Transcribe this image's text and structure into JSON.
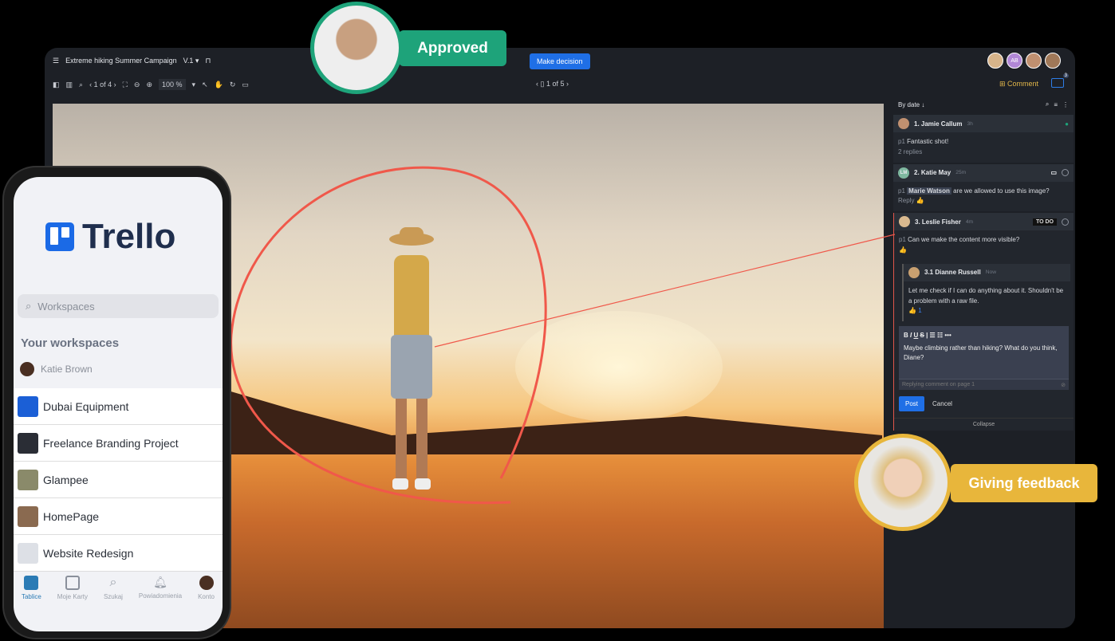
{
  "colors": {
    "accent": "#1f6fe6",
    "approved": "#1ea37a",
    "feedback": "#e8b63b",
    "comment": "#e2b64a"
  },
  "topbar": {
    "menu_icon": "hamburger-icon",
    "title": "Extreme hiking Summer Campaign",
    "version": "V.1",
    "decision_button": "Make decision",
    "avatars": [
      "",
      "AB",
      "",
      ""
    ]
  },
  "toolbar": {
    "pages": "1 of 4",
    "zoom": "100 %",
    "page_nav": "1 of 5",
    "comment_button": "Comment",
    "count_badge": "3"
  },
  "panel": {
    "sort": "By date",
    "comments": [
      {
        "author": "1. Jamie Callum",
        "time": "3h",
        "page": "p1",
        "text": "Fantastic shot!",
        "replies": "2 replies"
      },
      {
        "author": "2. Katie May",
        "initials": "LM",
        "time": "25m",
        "page": "p1",
        "mention": "Marie Watson",
        "text": "are we allowed to use this image?",
        "reply": "Reply"
      },
      {
        "author": "3. Leslie Fisher",
        "time": "4m",
        "status": "TO DO",
        "page": "p1",
        "text": "Can we make the content more visible?",
        "subreply": {
          "author": "3.1 Dianne Russell",
          "time": "Now",
          "text": "Let me check if I can do anything about it. Shouldn't be a problem with a raw file.",
          "likes": "1"
        }
      }
    ],
    "editor": {
      "text": "Maybe climbing rather than hiking? What do you think, Diane?",
      "placeholder": "Replying comment on page 1",
      "post": "Post",
      "cancel": "Cancel",
      "collapse": "Collapse"
    }
  },
  "badges": {
    "approved": "Approved",
    "feedback": "Giving feedback"
  },
  "phone": {
    "logo": "Trello",
    "search_placeholder": "Workspaces",
    "section": "Your workspaces",
    "user": "Katie Brown",
    "boards": [
      "Dubai Equipment",
      "Freelance Branding Project",
      "Glampee",
      "HomePage",
      "Website Redesign"
    ],
    "tabs": [
      "Tablice",
      "Moje Karty",
      "Szukaj",
      "Powiadomienia",
      "Konto"
    ]
  }
}
